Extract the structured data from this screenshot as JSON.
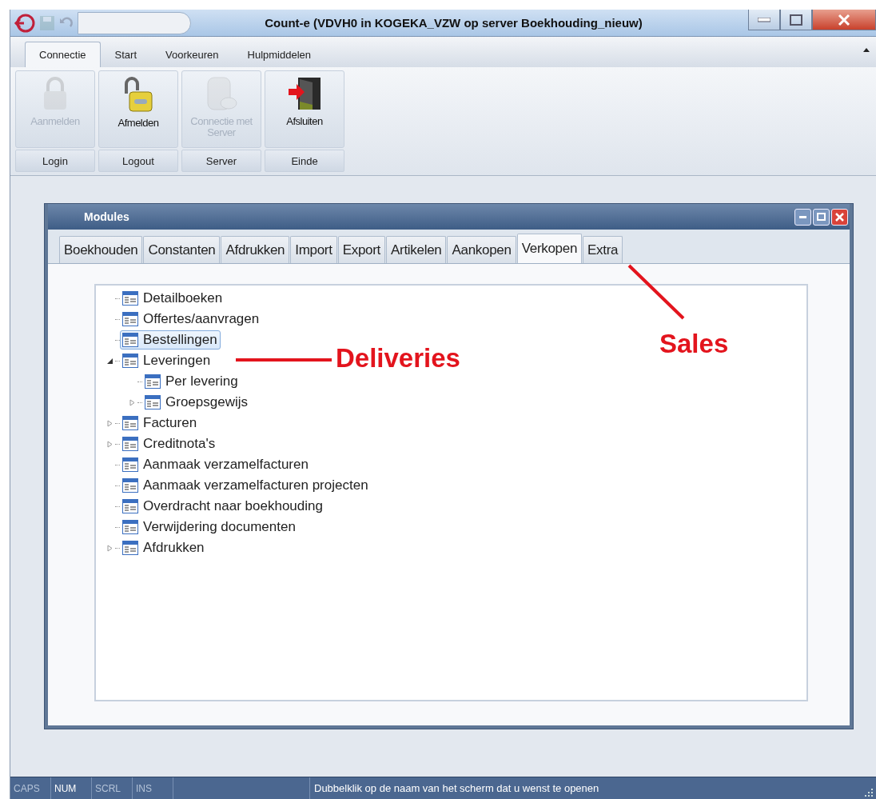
{
  "window": {
    "title": "Count-e (VDVH0 in KOGEKA_VZW op server Boekhouding_nieuw)"
  },
  "ribbon": {
    "tabs": [
      {
        "label": "Connectie",
        "selected": true
      },
      {
        "label": "Start",
        "selected": false
      },
      {
        "label": "Voorkeuren",
        "selected": false
      },
      {
        "label": "Hulpmiddelen",
        "selected": false
      }
    ],
    "groups": [
      {
        "label": "Login",
        "button": {
          "label": "Aanmelden",
          "kind": "lock",
          "disabled": true
        }
      },
      {
        "label": "Logout",
        "button": {
          "label": "Afmelden",
          "kind": "unlock",
          "disabled": false
        }
      },
      {
        "label": "Server",
        "button": {
          "label": "Connectie met Server",
          "kind": "database",
          "disabled": true
        }
      },
      {
        "label": "Einde",
        "button": {
          "label": "Afsluiten",
          "kind": "exit",
          "disabled": false
        }
      }
    ]
  },
  "modules": {
    "title": "Modules",
    "tabs": [
      {
        "label": "Boekhouden",
        "selected": false
      },
      {
        "label": "Constanten",
        "selected": false
      },
      {
        "label": "Afdrukken",
        "selected": false
      },
      {
        "label": "Import",
        "selected": false
      },
      {
        "label": "Export",
        "selected": false
      },
      {
        "label": "Artikelen",
        "selected": false
      },
      {
        "label": "Aankopen",
        "selected": false
      },
      {
        "label": "Verkopen",
        "selected": true
      },
      {
        "label": "Extra",
        "selected": false
      }
    ],
    "tree": [
      {
        "label": "Detailboeken",
        "selected": false
      },
      {
        "label": "Offertes/aanvragen",
        "selected": false
      },
      {
        "label": "Bestellingen",
        "selected": true
      },
      {
        "label": "Leveringen",
        "selected": false,
        "expanded": true,
        "children": [
          {
            "label": "Per levering",
            "selected": false
          },
          {
            "label": "Groepsgewijs",
            "selected": false,
            "expanded": false
          }
        ]
      },
      {
        "label": "Facturen",
        "selected": false,
        "expanded": false
      },
      {
        "label": "Creditnota's",
        "selected": false,
        "expanded": false
      },
      {
        "label": "Aanmaak verzamelfacturen",
        "selected": false
      },
      {
        "label": "Aanmaak verzamelfacturen projecten",
        "selected": false
      },
      {
        "label": "Overdracht naar boekhouding",
        "selected": false
      },
      {
        "label": "Verwijdering documenten",
        "selected": false
      },
      {
        "label": "Afdrukken",
        "selected": false,
        "expanded": false
      }
    ]
  },
  "annotations": [
    {
      "label": "Deliveries"
    },
    {
      "label": "Sales"
    }
  ],
  "status_bar": {
    "indicators": [
      {
        "label": "CAPS",
        "on": false
      },
      {
        "label": "NUM",
        "on": true
      },
      {
        "label": "SCRL",
        "on": false
      },
      {
        "label": "INS",
        "on": false
      }
    ],
    "message": "Dubbelklik op de naam van het scherm dat u wenst te openen"
  }
}
